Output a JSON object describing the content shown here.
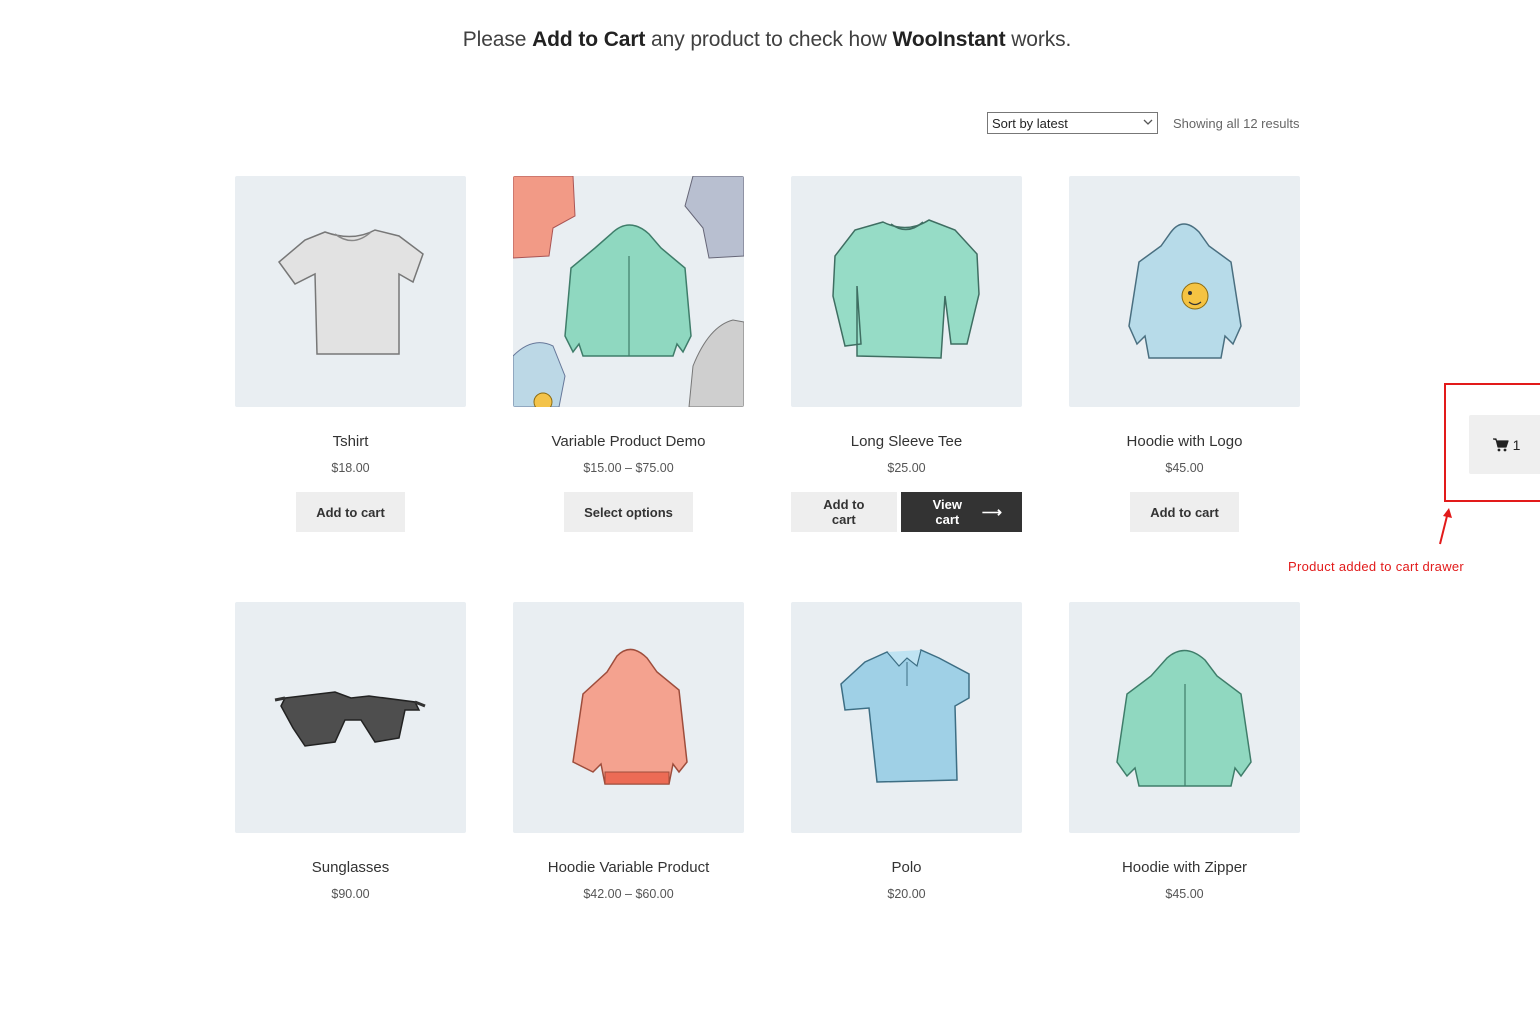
{
  "headline": {
    "prefix": "Please ",
    "strong1": "Add to Cart",
    "middle": " any product to check how ",
    "strong2": "WooInstant",
    "suffix": " works."
  },
  "toolbar": {
    "sort_value": "Sort by latest",
    "result_count": "Showing all 12 results"
  },
  "products": [
    {
      "name": "Tshirt",
      "price": "$18.00",
      "button": "Add to cart",
      "image": "tshirt-image"
    },
    {
      "name": "Variable Product Demo",
      "price": "$15.00 – $75.00",
      "button": "Select options",
      "image": "hoodie-pattern-image"
    },
    {
      "name": "Long Sleeve Tee",
      "price": "$25.00",
      "button": "Add to cart",
      "view_cart": "View cart",
      "image": "long-sleeve-tee-image"
    },
    {
      "name": "Hoodie with Logo",
      "price": "$45.00",
      "button": "Add to cart",
      "image": "hoodie-logo-image"
    },
    {
      "name": "Sunglasses",
      "price": "$90.00",
      "image": "sunglasses-image"
    },
    {
      "name": "Hoodie Variable Product",
      "price": "$42.00 – $60.00",
      "image": "red-hoodie-image"
    },
    {
      "name": "Polo",
      "price": "$20.00",
      "image": "polo-image"
    },
    {
      "name": "Hoodie with Zipper",
      "price": "$45.00",
      "image": "zip-hoodie-image"
    }
  ],
  "cart_drawer": {
    "count": "1",
    "icon": "cart-icon"
  },
  "annotation": "Product added to cart drawer",
  "colors": {
    "accent_dark": "#333333",
    "button_light": "#eeeeee",
    "thumb_bg": "#e9eef2",
    "annotation_red": "#e21a1a"
  }
}
